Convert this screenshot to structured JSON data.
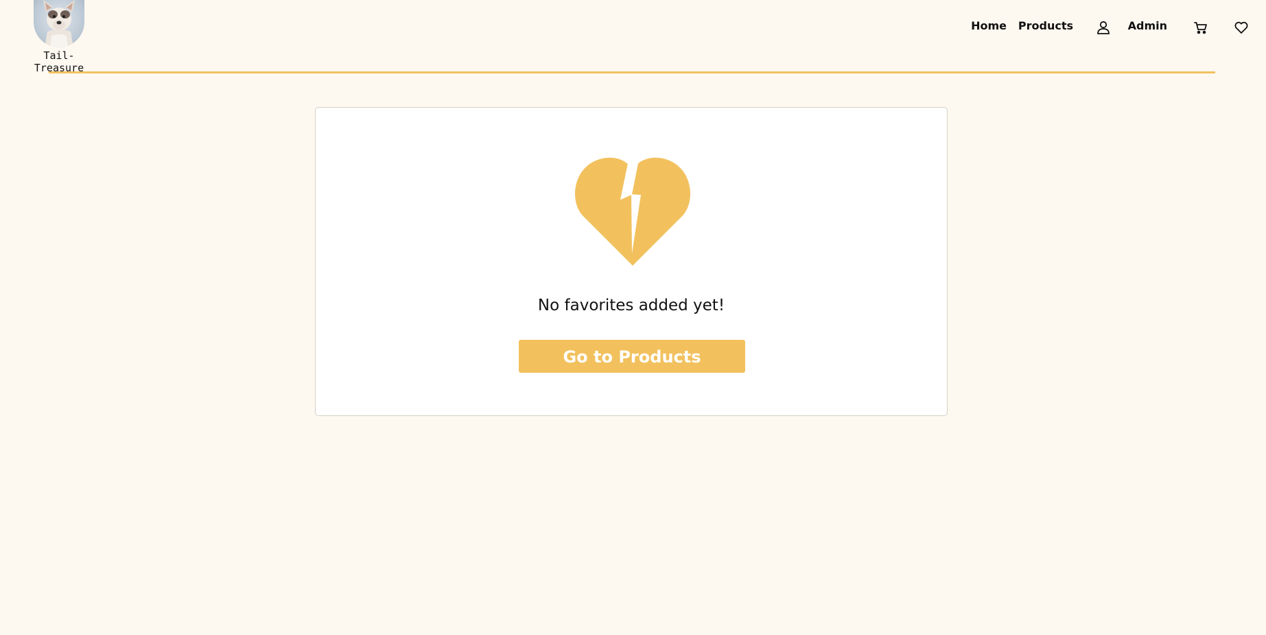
{
  "brand": {
    "name": "Tail-Treasure",
    "logo_icon": "bulldog-avatar"
  },
  "nav": {
    "home_label": "Home",
    "products_label": "Products",
    "user_icon": "user-icon",
    "admin_label": "Admin",
    "cart_icon": "cart-icon",
    "favorites_icon": "heart-icon"
  },
  "favorites": {
    "empty_icon": "broken-heart-icon",
    "empty_message": "No favorites added yet!",
    "cta_label": "Go to Products"
  },
  "colors": {
    "background": "#fdf8f0",
    "accent": "#f2c15e",
    "card_bg": "#ffffff"
  }
}
